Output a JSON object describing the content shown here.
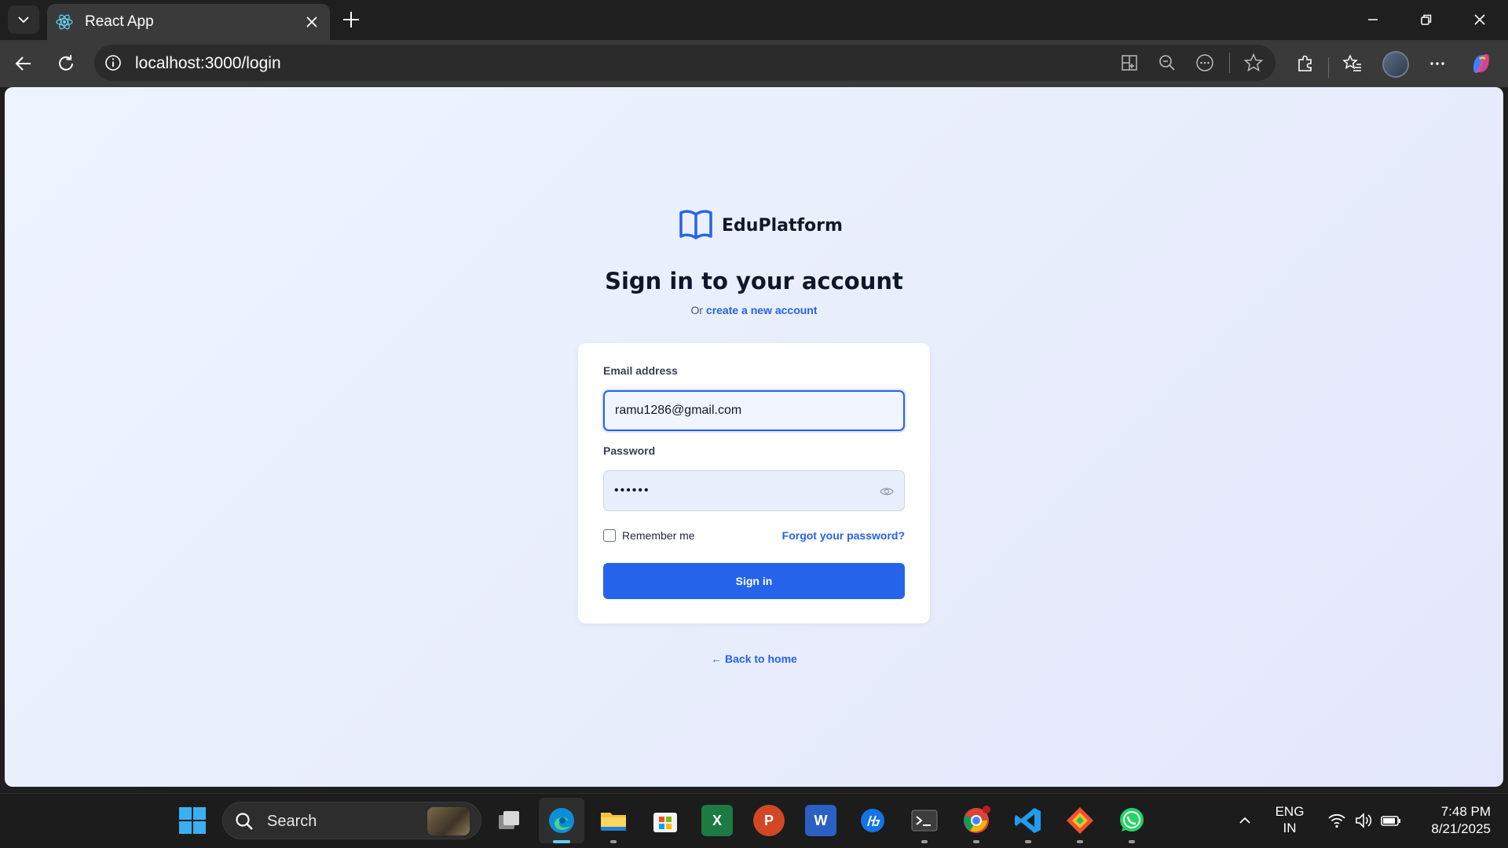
{
  "browser": {
    "tab_title": "React App",
    "url": "localhost:3000/login"
  },
  "page": {
    "brand_name": "EduPlatform",
    "heading": "Sign in to your account",
    "sub_prefix": "Or",
    "create_account_link": "create a new account",
    "email_label": "Email address",
    "email_value": "ramu1286@gmail.com",
    "password_label": "Password",
    "password_value": "••••••",
    "remember_label": "Remember me",
    "remember_checked": false,
    "forgot_link": "Forgot your password?",
    "signin_button": "Sign in",
    "back_link": "← Back to home"
  },
  "taskbar": {
    "search_label": "Search",
    "language_top": "ENG",
    "language_bottom": "IN",
    "time": "7:48 PM",
    "date": "8/21/2025"
  },
  "colors": {
    "accent": "#2563eb",
    "heading": "#0f172a"
  }
}
